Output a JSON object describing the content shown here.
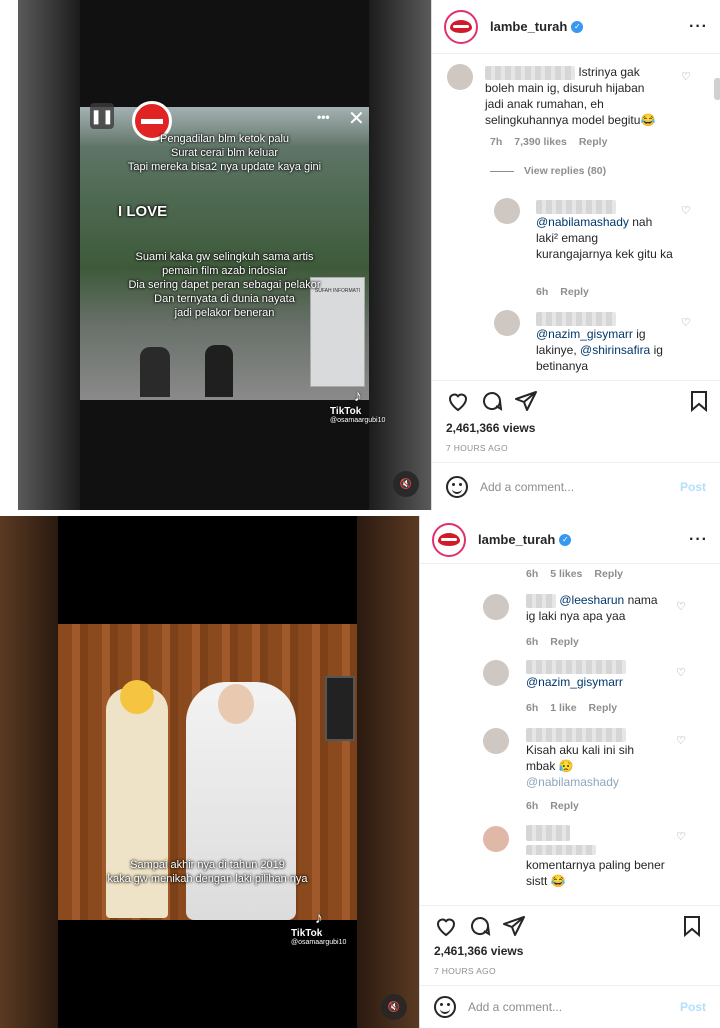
{
  "post1": {
    "account": "lambe_turah",
    "overlay_lines_top": [
      "Pengadilan blm ketok palu",
      "Surat cerai blm keluar",
      "Tapi mereka bisa2 nya update kaya gini"
    ],
    "overlay_i_love": "I LOVE",
    "overlay_lines_bottom": [
      "Suami kaka gw selingkuh sama artis",
      "pemain film azab indosiar",
      "Dia sering dapet peran sebagai pelakor",
      "Dan ternyata di dunia nayata",
      "jadi pelakor beneran"
    ],
    "sign_text": "SUFAH INFORMATI",
    "tiktok_label": "TikTok",
    "tiktok_handle": "@osamaargubi10",
    "comment_main": {
      "text": "Istrinya gak boleh main ig, disuruh hijaban jadi anak rumahan, eh selingkuhannya model begitu😂",
      "time": "7h",
      "likes": "7,390 likes",
      "reply": "Reply"
    },
    "view_replies": "View replies (80)",
    "reply1": {
      "mention": "@nabilamashady",
      "text": " nah laki² emang kurangajarnya kek gitu ka",
      "time": "6h",
      "reply": "Reply"
    },
    "reply2": {
      "mention1": "@nazim_gisymarr",
      "text1": " ig lakinye, ",
      "mention2": "@shirinsafira",
      "text2": " ig betinanya"
    },
    "views": "2,461,366 views",
    "ago": "7 HOURS AGO",
    "add_comment": "Add a comment...",
    "post_label": "Post"
  },
  "post2": {
    "account": "lambe_turah",
    "overlay_lines": [
      "Sampai akhir nya di tahun 2019",
      "kaka gw menikah dengan laki pilihan nya"
    ],
    "tiktok_label": "TikTok",
    "tiktok_handle": "@osamaargubi10",
    "top_meta": {
      "time": "6h",
      "likes": "5 likes",
      "reply": "Reply"
    },
    "c1": {
      "mention": "@leesharun",
      "text": " nama ig laki nya apa yaa",
      "time": "6h",
      "reply": "Reply"
    },
    "c2": {
      "mention": "@nazim_gisymarr",
      "time": "6h",
      "likes": "1 like",
      "reply": "Reply"
    },
    "c3": {
      "text": "Kisah aku kali ini sih mbak 😥",
      "mention": "@nabilamashady",
      "time": "6h",
      "reply": "Reply"
    },
    "c4": {
      "text": "komentarnya paling bener sistt 😂"
    },
    "views": "2,461,366 views",
    "ago": "7 HOURS AGO",
    "add_comment": "Add a comment...",
    "post_label": "Post"
  },
  "colors": {
    "accent": "#3897f0",
    "brand_ring": "#e1306c",
    "muted": "#8e8e8e"
  },
  "icons": [
    "verified-icon",
    "more-icon",
    "heart-icon",
    "comment-icon",
    "share-icon",
    "bookmark-icon",
    "emoji-icon",
    "mute-icon",
    "tiktok-icon"
  ]
}
